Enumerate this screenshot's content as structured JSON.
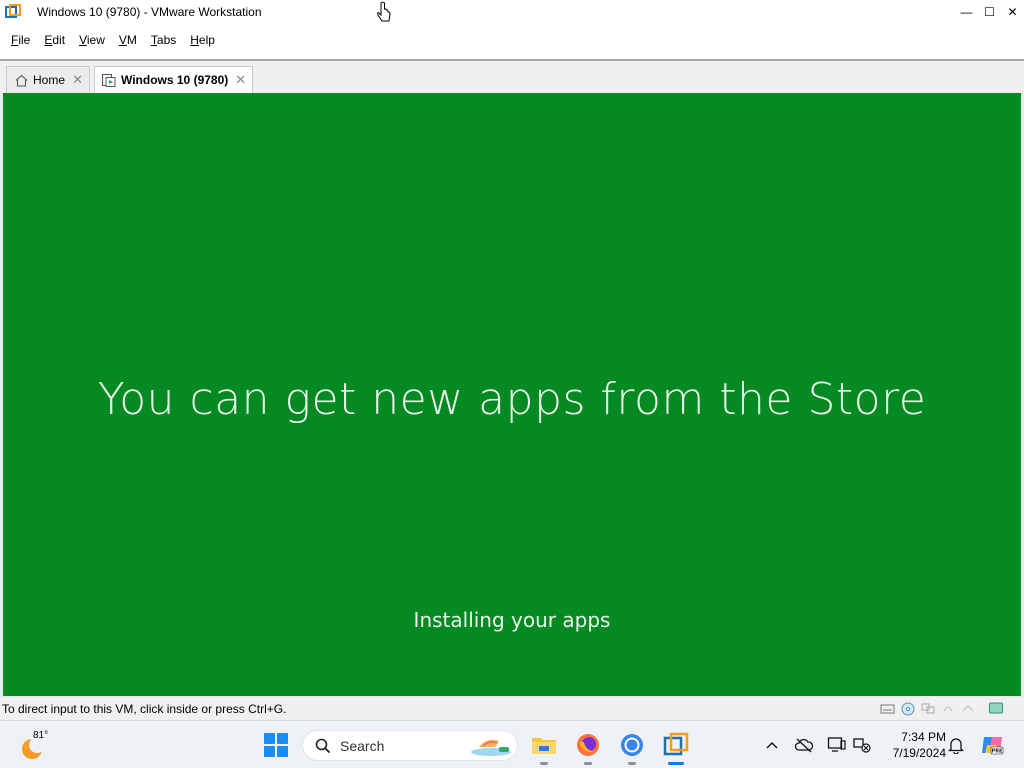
{
  "window": {
    "title": "Windows 10 (9780) - VMware Workstation",
    "controls": {
      "minimize": "—",
      "maximize": "☐",
      "close": "✕"
    }
  },
  "menu": [
    {
      "label": "File",
      "key": "F",
      "rest": "ile"
    },
    {
      "label": "Edit",
      "key": "E",
      "rest": "dit"
    },
    {
      "label": "View",
      "key": "V",
      "rest": "iew"
    },
    {
      "label": "VM",
      "key": "V",
      "rest": "M"
    },
    {
      "label": "Tabs",
      "key": "T",
      "rest": "abs"
    },
    {
      "label": "Help",
      "key": "H",
      "rest": "elp"
    }
  ],
  "tabs": {
    "home": {
      "label": "Home",
      "icon": "home-icon"
    },
    "vm": {
      "label": "Windows 10 (9780)",
      "icon": "vm-icon"
    }
  },
  "vm_screen": {
    "background": "#058a23",
    "headline": "You can get new apps from the Store",
    "subtext": "Installing your apps"
  },
  "statusbar": {
    "text": "To direct input to this VM, click inside or press Ctrl+G."
  },
  "taskbar": {
    "weather_temp": "81°",
    "search_label": "Search",
    "apps": [
      "file-explorer",
      "firefox",
      "chrome",
      "vmware-workstation"
    ],
    "clock_time": "7:34 PM",
    "clock_date": "7/19/2024"
  },
  "colors": {
    "accent": "#1a8cf0",
    "vm_green": "#058a23"
  }
}
